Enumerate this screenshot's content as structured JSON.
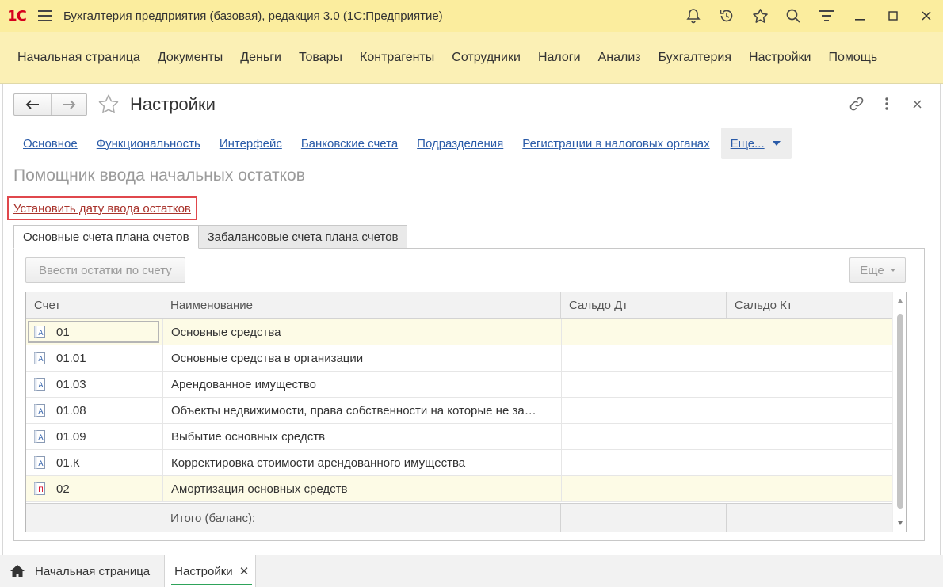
{
  "app": {
    "logo": "1С",
    "title": "Бухгалтерия предприятия (базовая), редакция 3.0  (1С:Предприятие)"
  },
  "main_menu": [
    "Начальная страница",
    "Документы",
    "Деньги",
    "Товары",
    "Контрагенты",
    "Сотрудники",
    "Налоги",
    "Анализ",
    "Бухгалтерия",
    "Настройки",
    "Помощь"
  ],
  "form": {
    "title": "Настройки",
    "links": [
      "Основное",
      "Функциональность",
      "Интерфейс",
      "Банковские счета",
      "Подразделения",
      "Регистрации в налоговых органах"
    ],
    "more_label": "Еще...",
    "assistant_title": "Помощник ввода начальных остатков",
    "set_date_link": "Установить дату ввода остатков"
  },
  "tabs": [
    "Основные счета плана счетов",
    "Забалансовые счета плана счетов"
  ],
  "toolbar": {
    "enter_balance_label": "Ввести остатки по счету",
    "more_label": "Еще"
  },
  "grid": {
    "columns": [
      "Счет",
      "Наименование",
      "Сальдо Дт",
      "Сальдо Кт"
    ],
    "rows": [
      {
        "code": "01",
        "name": "Основные средства",
        "type": "A",
        "highlighted": true,
        "selected": true
      },
      {
        "code": "01.01",
        "name": "Основные средства в организации",
        "type": "A",
        "highlighted": false,
        "selected": false
      },
      {
        "code": "01.03",
        "name": "Арендованное имущество",
        "type": "A",
        "highlighted": false,
        "selected": false
      },
      {
        "code": "01.08",
        "name": "Объекты недвижимости, права собственности на которые не за…",
        "type": "A",
        "highlighted": false,
        "selected": false
      },
      {
        "code": "01.09",
        "name": "Выбытие основных средств",
        "type": "A",
        "highlighted": false,
        "selected": false
      },
      {
        "code": "01.К",
        "name": "Корректировка стоимости арендованного имущества",
        "type": "A",
        "highlighted": false,
        "selected": false
      },
      {
        "code": "02",
        "name": "Амортизация основных средств",
        "type": "П",
        "highlighted": true,
        "selected": false
      }
    ],
    "footer_label": "Итого (баланс):"
  },
  "taskbar": {
    "home_label": "Начальная страница",
    "active_label": "Настройки",
    "close_glyph": "✕"
  },
  "colors": {
    "titlebar": "#fbed9e",
    "menubar": "#fbf0b5",
    "link": "#2a5ba8",
    "highlight_box": "#e0474c",
    "active_tab_underline": "#2ea35a",
    "account_icon_active": "#2a5ba8",
    "account_icon_passive": "#d6001c"
  }
}
